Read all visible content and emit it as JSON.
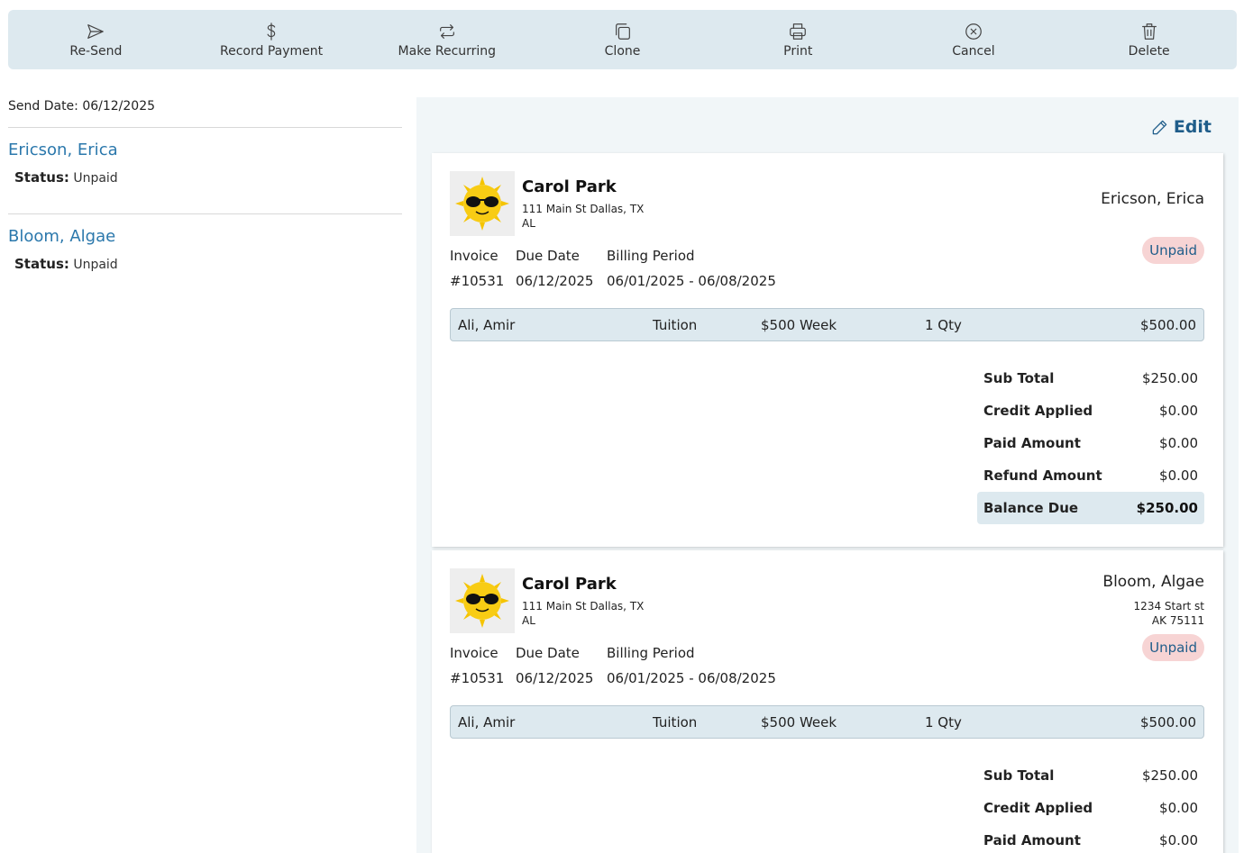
{
  "toolbar": {
    "resend": "Re-Send",
    "record_payment": "Record Payment",
    "make_recurring": "Make Recurring",
    "clone": "Clone",
    "print": "Print",
    "cancel": "Cancel",
    "delete": "Delete"
  },
  "sidebar": {
    "send_date": "Send Date: 06/12/2025",
    "status_label": "Status:",
    "recipients": [
      {
        "name": "Ericson, Erica",
        "status": "Unpaid"
      },
      {
        "name": "Bloom, Algae",
        "status": "Unpaid"
      }
    ]
  },
  "edit_label": "Edit",
  "invoices": [
    {
      "business_name": "Carol Park",
      "business_address_line1": "111 Main St Dallas, TX",
      "business_address_line2": "AL",
      "client_name": "Ericson, Erica",
      "status": "Unpaid",
      "invoice_label": "Invoice",
      "invoice_number": "#10531",
      "due_date_label": "Due Date",
      "due_date": "06/12/2025",
      "billing_period_label": "Billing Period",
      "billing_period": "06/01/2025 - 06/08/2025",
      "line_item": {
        "student": "Ali, Amir",
        "description": "Tuition",
        "rate": "$500 Week",
        "qty": "1 Qty",
        "amount": "$500.00"
      },
      "totals": {
        "sub_total_label": "Sub Total",
        "sub_total": "$250.00",
        "credit_applied_label": "Credit Applied",
        "credit_applied": "$0.00",
        "paid_amount_label": "Paid Amount",
        "paid_amount": "$0.00",
        "refund_amount_label": "Refund Amount",
        "refund_amount": "$0.00",
        "balance_due_label": "Balance Due",
        "balance_due": "$250.00"
      }
    },
    {
      "business_name": "Carol Park",
      "business_address_line1": "111 Main St Dallas, TX",
      "business_address_line2": "AL",
      "client_name": "Bloom, Algae",
      "client_address_line1": "1234 Start st",
      "client_address_line2": "AK 75111",
      "status": "Unpaid",
      "invoice_label": "Invoice",
      "invoice_number": "#10531",
      "due_date_label": "Due Date",
      "due_date": "06/12/2025",
      "billing_period_label": "Billing Period",
      "billing_period": "06/01/2025 - 06/08/2025",
      "line_item": {
        "student": "Ali, Amir",
        "description": "Tuition",
        "rate": "$500 Week",
        "qty": "1 Qty",
        "amount": "$500.00"
      },
      "totals": {
        "sub_total_label": "Sub Total",
        "sub_total": "$250.00",
        "credit_applied_label": "Credit Applied",
        "credit_applied": "$0.00",
        "paid_amount_label": "Paid Amount",
        "paid_amount": "$0.00"
      }
    }
  ],
  "colors": {
    "toolbar_bg": "#dde9ef",
    "link_blue": "#2b78ac",
    "unpaid_badge_bg": "#f7d4d4",
    "panel_bg": "#f1f6f8"
  }
}
